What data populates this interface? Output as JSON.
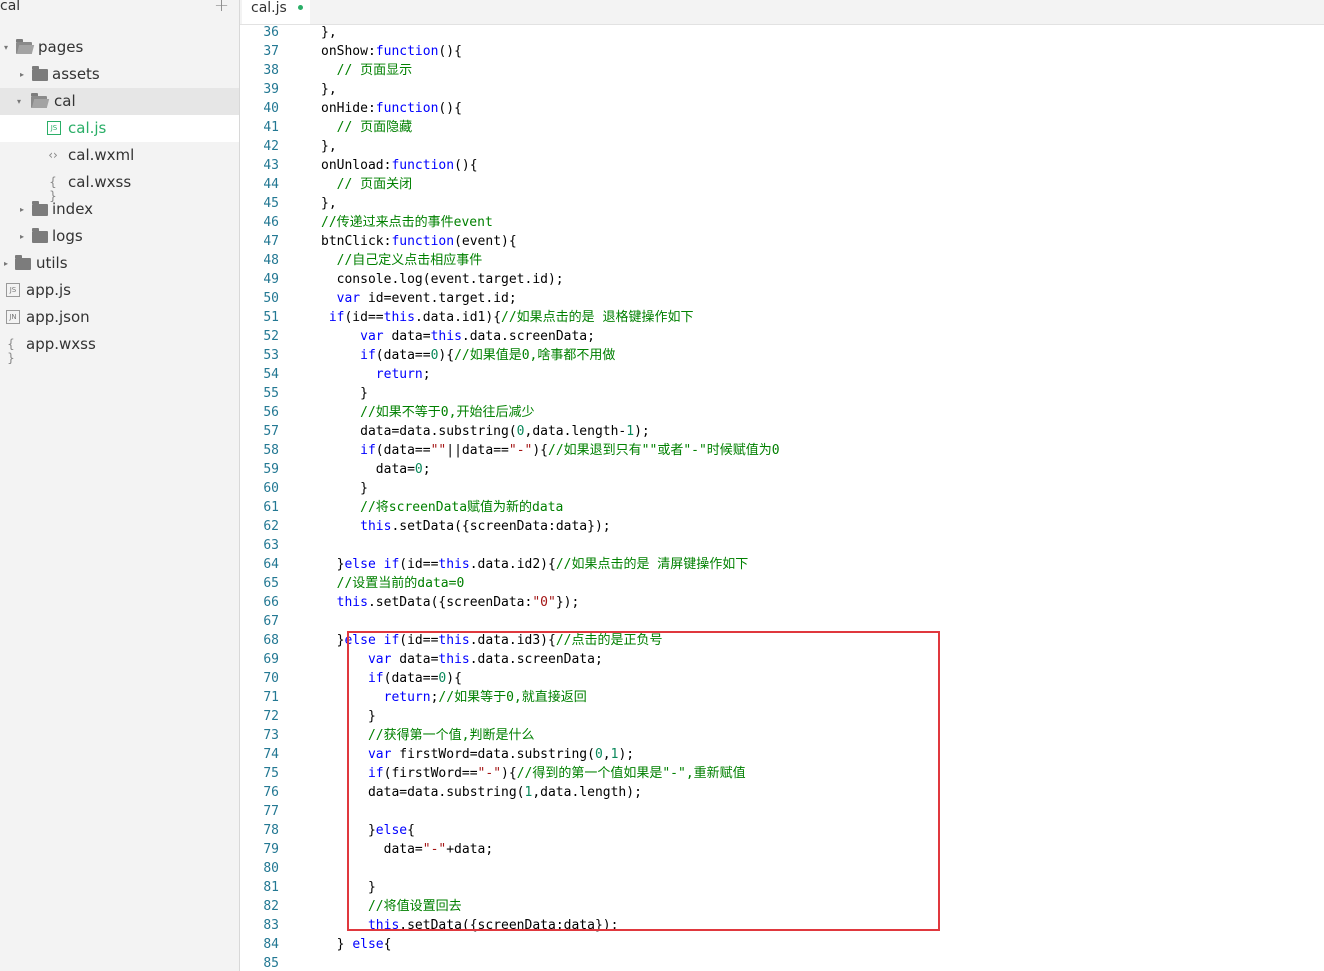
{
  "sidebar": {
    "title": "cal",
    "add_icon": "plus-icon",
    "items": [
      {
        "label": "pages",
        "icon": "folder-open-icon"
      },
      {
        "label": "assets",
        "icon": "folder-icon"
      },
      {
        "label": "cal",
        "icon": "folder-open-icon"
      },
      {
        "label": "cal.js",
        "icon": "js-file-icon"
      },
      {
        "label": "cal.wxml",
        "icon": "code-file-icon"
      },
      {
        "label": "cal.wxss",
        "icon": "braces-file-icon"
      },
      {
        "label": "index",
        "icon": "folder-icon"
      },
      {
        "label": "logs",
        "icon": "folder-icon"
      },
      {
        "label": "utils",
        "icon": "folder-icon"
      },
      {
        "label": "app.js",
        "icon": "js-file-icon"
      },
      {
        "label": "app.json",
        "icon": "json-file-icon"
      },
      {
        "label": "app.wxss",
        "icon": "braces-file-icon"
      }
    ]
  },
  "tabs": [
    {
      "label": "cal.js",
      "modified": true
    }
  ],
  "colors": {
    "keyword": "#0000ff",
    "comment": "#008000",
    "string": "#a31515",
    "number": "#09885a",
    "line_number": "#237893",
    "accent": "#2aae67",
    "highlight_border": "#e0383e"
  },
  "editor": {
    "lines": [
      {
        "n": "36",
        "t": "},"
      },
      {
        "n": "37",
        "t": "onShow:function(){"
      },
      {
        "n": "38",
        "t": "  // 页面显示"
      },
      {
        "n": "39",
        "t": "},"
      },
      {
        "n": "40",
        "t": "onHide:function(){"
      },
      {
        "n": "41",
        "t": "  // 页面隐藏"
      },
      {
        "n": "42",
        "t": "},"
      },
      {
        "n": "43",
        "t": "onUnload:function(){"
      },
      {
        "n": "44",
        "t": "  // 页面关闭"
      },
      {
        "n": "45",
        "t": "},"
      },
      {
        "n": "46",
        "t": "//传递过来点击的事件event"
      },
      {
        "n": "47",
        "t": "btnClick:function(event){"
      },
      {
        "n": "48",
        "t": "  //自己定义点击相应事件"
      },
      {
        "n": "49",
        "t": "  console.log(event.target.id);"
      },
      {
        "n": "50",
        "t": "  var id=event.target.id;"
      },
      {
        "n": "51",
        "t": " if(id==this.data.id1){//如果点击的是 退格键操作如下"
      },
      {
        "n": "52",
        "t": "     var data=this.data.screenData;"
      },
      {
        "n": "53",
        "t": "     if(data==0){//如果值是0,啥事都不用做"
      },
      {
        "n": "54",
        "t": "       return;"
      },
      {
        "n": "55",
        "t": "     }"
      },
      {
        "n": "56",
        "t": "     //如果不等于0,开始往后减少"
      },
      {
        "n": "57",
        "t": "     data=data.substring(0,data.length-1);"
      },
      {
        "n": "58",
        "t": "     if(data==\"\"||data==\"-\"){//如果退到只有\"\"或者\"-\"时候赋值为0"
      },
      {
        "n": "59",
        "t": "       data=0;"
      },
      {
        "n": "60",
        "t": "     }"
      },
      {
        "n": "61",
        "t": "     //将screenData赋值为新的data"
      },
      {
        "n": "62",
        "t": "     this.setData({screenData:data});"
      },
      {
        "n": "63",
        "t": ""
      },
      {
        "n": "64",
        "t": "  }else if(id==this.data.id2){//如果点击的是 清屏键操作如下"
      },
      {
        "n": "65",
        "t": "  //设置当前的data=0"
      },
      {
        "n": "66",
        "t": "  this.setData({screenData:\"0\"});"
      },
      {
        "n": "67",
        "t": ""
      },
      {
        "n": "68",
        "t": "  }else if(id==this.data.id3){//点击的是正负号"
      },
      {
        "n": "69",
        "t": "      var data=this.data.screenData;"
      },
      {
        "n": "70",
        "t": "      if(data==0){"
      },
      {
        "n": "71",
        "t": "        return;//如果等于0,就直接返回"
      },
      {
        "n": "72",
        "t": "      }"
      },
      {
        "n": "73",
        "t": "      //获得第一个值,判断是什么"
      },
      {
        "n": "74",
        "t": "      var firstWord=data.substring(0,1);"
      },
      {
        "n": "75",
        "t": "      if(firstWord==\"-\"){//得到的第一个值如果是\"-\",重新赋值"
      },
      {
        "n": "76",
        "t": "      data=data.substring(1,data.length);"
      },
      {
        "n": "77",
        "t": ""
      },
      {
        "n": "78",
        "t": "      }else{"
      },
      {
        "n": "79",
        "t": "        data=\"-\"+data;"
      },
      {
        "n": "80",
        "t": ""
      },
      {
        "n": "81",
        "t": "      }"
      },
      {
        "n": "82",
        "t": "      //将值设置回去"
      },
      {
        "n": "83",
        "t": "      this.setData({screenData:data});"
      },
      {
        "n": "84",
        "t": "  } else{"
      },
      {
        "n": "85",
        "t": ""
      }
    ]
  }
}
